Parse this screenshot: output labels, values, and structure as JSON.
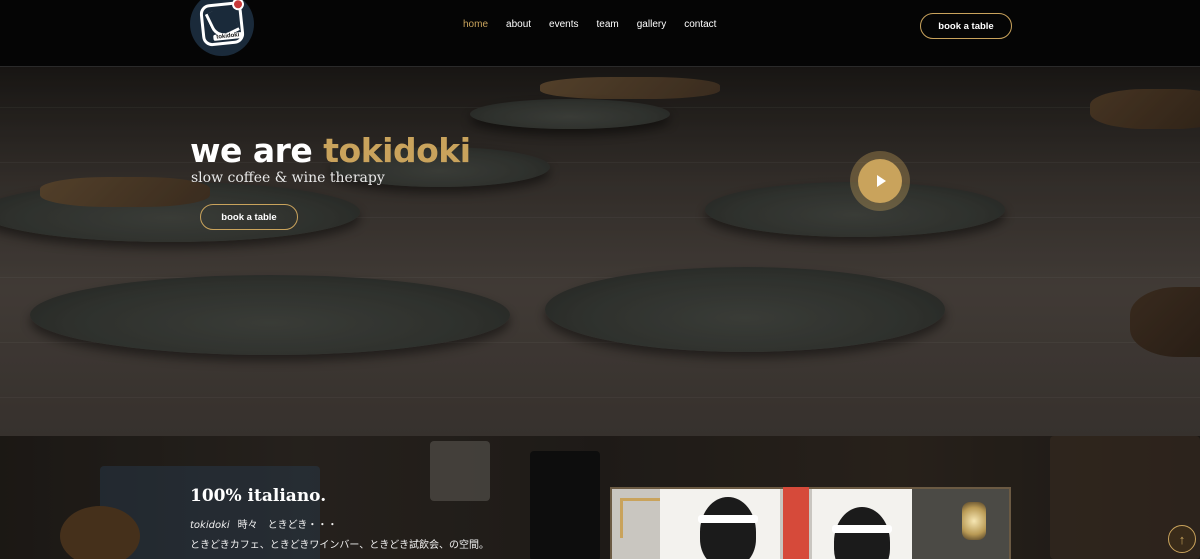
{
  "header": {
    "logo_text": "tokidoki",
    "nav": [
      {
        "label": "home",
        "active": true
      },
      {
        "label": "about",
        "active": false
      },
      {
        "label": "events",
        "active": false
      },
      {
        "label": "team",
        "active": false
      },
      {
        "label": "gallery",
        "active": false
      },
      {
        "label": "contact",
        "active": false
      }
    ],
    "cta_label": "book a table"
  },
  "hero": {
    "title_prefix": "we are ",
    "title_accent": "tokidoki",
    "subtitle": "slow coffee & wine therapy",
    "cta_label": "book a table",
    "play_icon": "play-icon"
  },
  "about": {
    "title": "100% italiano.",
    "brand": "tokidoki",
    "line1": "時々　ときどき・・・",
    "line2": "ときどきカフェ、ときどきワインバー、ときどき試飲会、の空間。"
  },
  "colors": {
    "accent": "#c9a35c",
    "header_bg": "#050505",
    "flag_red": "#d64a3a"
  },
  "scroll_top_icon": "↑"
}
